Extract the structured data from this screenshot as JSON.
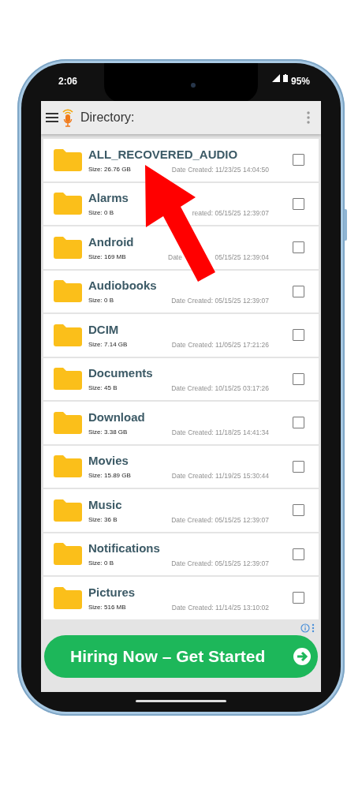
{
  "status_bar": {
    "time": "2:06",
    "battery": "95%"
  },
  "app_bar": {
    "title": "Directory:"
  },
  "folders": [
    {
      "name": "ALL_RECOVERED_AUDIO",
      "size": "Size: 26.76 GB",
      "date": "Date Created: 11/23/25 14:04:50",
      "checked": false
    },
    {
      "name": "Alarms",
      "size": "Size: 0 B",
      "date": "reated: 05/15/25 12:39:07",
      "checked": false
    },
    {
      "name": "Android",
      "size": "Size: 169 MB",
      "date_fragment": "Date",
      "date": "05/15/25 12:39:04",
      "checked": false
    },
    {
      "name": "Audiobooks",
      "size": "Size: 0 B",
      "date": "Date Created: 05/15/25 12:39:07",
      "checked": false
    },
    {
      "name": "DCIM",
      "size": "Size: 7.14 GB",
      "date": "Date Created: 11/05/25 17:21:26",
      "checked": false
    },
    {
      "name": "Documents",
      "size": "Size: 45 B",
      "date": "Date Created: 10/15/25 03:17:26",
      "checked": false
    },
    {
      "name": "Download",
      "size": "Size: 3.38 GB",
      "date": "Date Created: 11/18/25 14:41:34",
      "checked": false
    },
    {
      "name": "Movies",
      "size": "Size: 15.89 GB",
      "date": "Date Created: 11/19/25 15:30:44",
      "checked": false
    },
    {
      "name": "Music",
      "size": "Size: 36 B",
      "date": "Date Created: 05/15/25 12:39:07",
      "checked": false
    },
    {
      "name": "Notifications",
      "size": "Size: 0 B",
      "date": "Date Created: 05/15/25 12:39:07",
      "checked": false
    },
    {
      "name": "Pictures",
      "size": "Size: 516 MB",
      "date": "Date Created: 11/14/25 13:10:02",
      "checked": false
    }
  ],
  "ad": {
    "text": "Hiring Now – Get Started"
  }
}
